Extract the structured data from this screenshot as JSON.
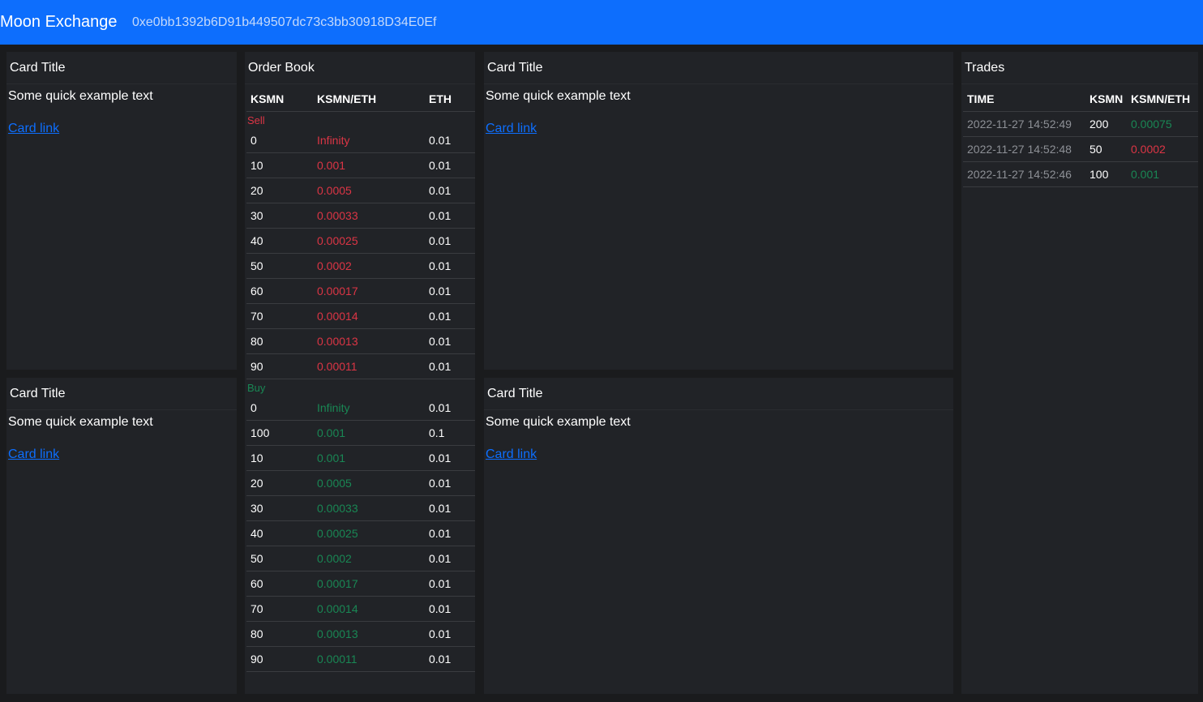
{
  "navbar": {
    "brand": "Moon Exchange",
    "account": "0xe0bb1392b6D91b449507dc73c3bb30918D34E0Ef"
  },
  "cards": [
    {
      "title": "Card Title",
      "text": "Some quick example text",
      "link": "Card link"
    },
    {
      "title": "Card Title",
      "text": "Some quick example text",
      "link": "Card link"
    },
    {
      "title": "Card Title",
      "text": "Some quick example text",
      "link": "Card link"
    },
    {
      "title": "Card Title",
      "text": "Some quick example text",
      "link": "Card link"
    }
  ],
  "order_book": {
    "title": "Order Book",
    "headers": [
      "KSMN",
      "KSMN/ETH",
      "ETH"
    ],
    "sell_label": "Sell",
    "buy_label": "Buy",
    "sell": [
      [
        "0",
        "Infinity",
        "0.01"
      ],
      [
        "10",
        "0.001",
        "0.01"
      ],
      [
        "20",
        "0.0005",
        "0.01"
      ],
      [
        "30",
        "0.00033",
        "0.01"
      ],
      [
        "40",
        "0.00025",
        "0.01"
      ],
      [
        "50",
        "0.0002",
        "0.01"
      ],
      [
        "60",
        "0.00017",
        "0.01"
      ],
      [
        "70",
        "0.00014",
        "0.01"
      ],
      [
        "80",
        "0.00013",
        "0.01"
      ],
      [
        "90",
        "0.00011",
        "0.01"
      ]
    ],
    "buy": [
      [
        "0",
        "Infinity",
        "0.01"
      ],
      [
        "100",
        "0.001",
        "0.1"
      ],
      [
        "10",
        "0.001",
        "0.01"
      ],
      [
        "20",
        "0.0005",
        "0.01"
      ],
      [
        "30",
        "0.00033",
        "0.01"
      ],
      [
        "40",
        "0.00025",
        "0.01"
      ],
      [
        "50",
        "0.0002",
        "0.01"
      ],
      [
        "60",
        "0.00017",
        "0.01"
      ],
      [
        "70",
        "0.00014",
        "0.01"
      ],
      [
        "80",
        "0.00013",
        "0.01"
      ],
      [
        "90",
        "0.00011",
        "0.01"
      ]
    ],
    "colors": {
      "sell": "#dc3545",
      "buy": "#198754"
    }
  },
  "trades": {
    "title": "Trades",
    "headers": [
      "TIME",
      "KSMN",
      "KSMN/ETH"
    ],
    "rows": [
      {
        "time": "2022-11-27 14:52:49",
        "ksmn": "200",
        "price": "0.00075",
        "side": "buy"
      },
      {
        "time": "2022-11-27 14:52:48",
        "ksmn": "50",
        "price": "0.0002",
        "side": "sell"
      },
      {
        "time": "2022-11-27 14:52:46",
        "ksmn": "100",
        "price": "0.001",
        "side": "buy"
      }
    ]
  },
  "colors": {
    "navbar": "#0d6efd",
    "link": "#0d6efd",
    "background": "#212327"
  }
}
